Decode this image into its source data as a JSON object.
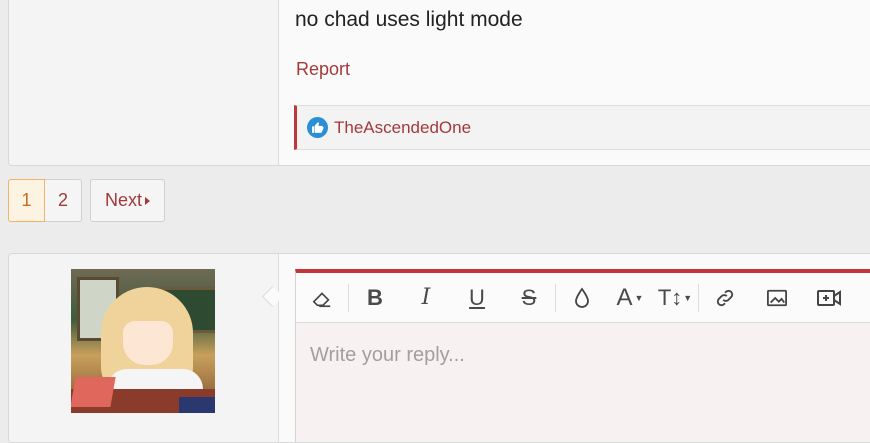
{
  "post": {
    "message": "no chad uses light mode",
    "report_label": "Report",
    "reaction": {
      "icon": "thumbs-up-icon",
      "reactor": "TheAscendedOne",
      "accent": "#2b8fd6"
    }
  },
  "pagination": {
    "pages": [
      "1",
      "2"
    ],
    "current": "1",
    "next_label": "Next"
  },
  "reply": {
    "placeholder": "Write your reply...",
    "avatar_alt": "anime girl avatar",
    "toolbar": [
      "eraser-icon",
      "bold-icon",
      "italic-icon",
      "underline-icon",
      "strikethrough-icon",
      "text-color-icon",
      "font-family-icon",
      "font-size-icon",
      "link-icon",
      "image-icon",
      "video-icon"
    ]
  },
  "colors": {
    "link": "#a23a3a",
    "editor_accent": "#c0363b",
    "current_page_border": "#f0b36b"
  }
}
